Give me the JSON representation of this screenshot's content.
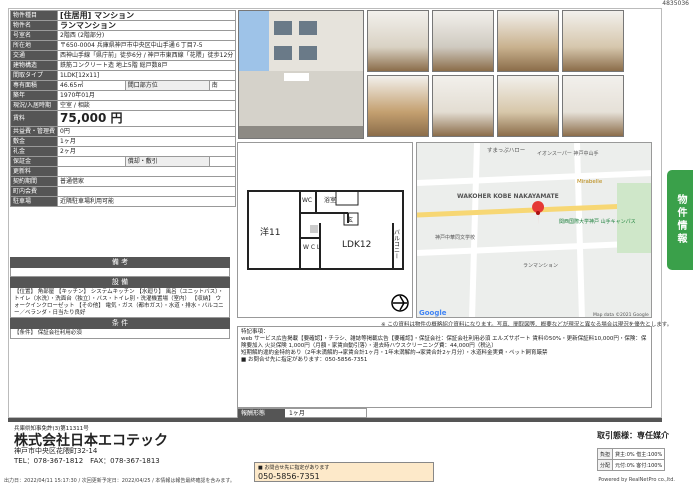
{
  "doc_id": "4835036",
  "property_rows": [
    {
      "label": "物件種目",
      "value": "[住居用] マンション",
      "cls": "mid"
    },
    {
      "label": "物件名",
      "value": "ランマンション",
      "cls": "mid"
    },
    {
      "label": "号室名",
      "value": "2階西 (2階部分)"
    },
    {
      "label": "所在地",
      "value": "〒650-0004 兵庫県神戸市中央区中山手通６丁目7-5"
    },
    {
      "label": "交通",
      "value": "西神山手線「県庁前」徒歩6分 / 神戸市東西線「花隈」徒歩12分"
    },
    {
      "label": "建物構造",
      "value": "鉄筋コンクリート造 地上5階 総戸数8戸"
    },
    {
      "label": "間取タイプ",
      "value": "1LDK[12x11]"
    },
    {
      "label": "専有面積",
      "value": "46.65㎡",
      "extra_label": "間口部方位",
      "extra_value": "南"
    },
    {
      "label": "築年",
      "value": "1970年01月"
    },
    {
      "label": "現況/入居時期",
      "value": "空室 / 相談"
    },
    {
      "label": "賃料",
      "value": "75,000 円",
      "cls": "big"
    },
    {
      "label": "共益費・管理費",
      "value": "0円"
    },
    {
      "label": "敷金",
      "value": "1ヶ月"
    },
    {
      "label": "礼金",
      "value": "2ヶ月"
    },
    {
      "label": "保証金",
      "value": "",
      "extra_label": "償却・敷引",
      "extra_value": ""
    },
    {
      "label": "更新料",
      "value": ""
    },
    {
      "label": "契約期間",
      "value": "普通借家"
    },
    {
      "label": "町内会費",
      "value": ""
    },
    {
      "label": "駐車場",
      "value": "近隣駐車場利用可能"
    }
  ],
  "sections": {
    "bikou": "備 考",
    "setsubi": "設 備",
    "jouken": "条 件"
  },
  "setsubi_text": "【位置】 角部屋 【キッチン】 システムキッチン 【水廻り】 風呂（ユニットバス）・トイレ（水洗）・洗面台（独立）・バス・トイレ別・洗濯機置場（室内） 【収納】 ウォークインクローゼット 【その他】 電気・ガス（都市ガス）・水道・排水・バルコニー／ベランダ・日当たり良好",
  "jouken_text": "【条件】 保証会社利用必須",
  "floorplan": {
    "rooms": {
      "western": "洋11",
      "ldk": "LDK12",
      "bath": "浴室",
      "wc1": "WC",
      "wc2": "W C L",
      "ent": "玄",
      "balcony": "バルコニー"
    }
  },
  "map": {
    "labels": [
      "すまっぷハロー",
      "イオンスーパー 神戸中山手",
      "Mirabelle",
      "WAKOHER KOBE NAKAYAMATE",
      "神戸中華同文学校",
      "関西国際大学神戸 山手キャンパス",
      "ランマンション",
      "Google",
      "Map data ©2021 Google"
    ]
  },
  "image_note": "※ この資料は物件の概略紹介資料になります。写真、間取図等、概要などが現況と異なる場合は現況を優先とします。",
  "tokki": {
    "title": "特記事項：",
    "lines": [
      "web サービス広告掲載【要確認】・チラシ、雑誌等掲載広告【要確認】・保証会社：保証会社利用必須 エルズサポート 賃料の50%・更新保証料10,000円・保険：保険要加入 火災保険 1,000円（月額・家賃自動引落）・退去時ハウスクリーニング費：44,000円（税込）",
      "短期解約違約金特約あり（2年未満解約→家賃合計1ヶ月・1年未満解約→家賃合計2ヶ月分）・水道料金実費・ペット飼育厳禁",
      "■ お問合せ先に指定があります：050-5856-7351"
    ]
  },
  "period": {
    "label": "報酬形態",
    "value": "1ヶ月"
  },
  "side_tab": "物件情報",
  "company": {
    "license": "兵庫県知事免許(3)第11311号",
    "name": "株式会社日本エコテック",
    "address": "神戸市中央区花隈町32-14",
    "tel": "TEL：078-367-1812　FAX：078-367-1813"
  },
  "contact": {
    "label": "■ お問合せ先に指定があります",
    "phone": "050-5856-7351"
  },
  "deal": {
    "title": "取引態様：専任媒介",
    "fees": [
      {
        "k": "負担",
        "v": "貸主:0% 借主:100%"
      },
      {
        "k": "分配",
        "v": "元付:0% 客付:100%"
      }
    ]
  },
  "footer": {
    "left": "出力日：2022/04/11 15:17:30 / 次回更新予定日：2022/04/25 / 本情報は報告最終確認を含みます。",
    "right": "Powered by RealNetPro co.,ltd."
  }
}
